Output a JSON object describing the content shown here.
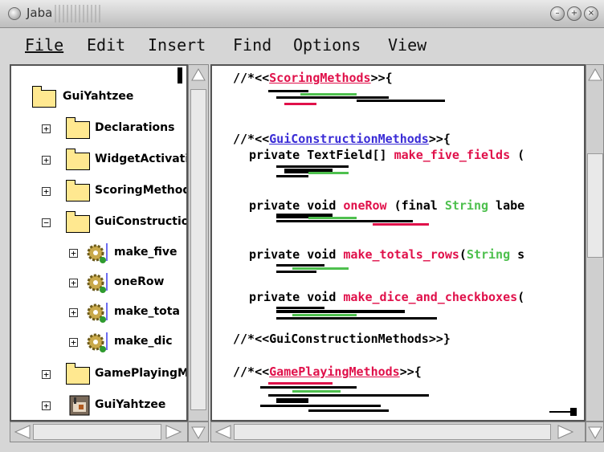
{
  "window": {
    "title": "Jaba"
  },
  "menu": [
    "File",
    "Edit",
    "Insert",
    "Find",
    "Options",
    "View"
  ],
  "tree": {
    "root": "GuiYahtzee",
    "nodes": [
      {
        "label": "Declarations",
        "expander": "+"
      },
      {
        "label": "WidgetActivatio",
        "expander": "+"
      },
      {
        "label": "ScoringMethod",
        "expander": "+"
      },
      {
        "label": "GuiConstructio",
        "expander": "−"
      },
      {
        "label": "make_five",
        "expander": "+"
      },
      {
        "label": "oneRow",
        "expander": "+"
      },
      {
        "label": "make_tota",
        "expander": "+"
      },
      {
        "label": "make_dic",
        "expander": "+"
      },
      {
        "label": "GamePlayingM",
        "expander": "+"
      },
      {
        "label": "GuiYahtzee",
        "expander": "+"
      }
    ]
  },
  "code": {
    "scoring_open": {
      "prefix": "//*<<",
      "name": "ScoringMethods",
      "suffix": ">>{"
    },
    "gui_open": {
      "prefix": "//*<<",
      "name": "GuiConstructionMethods",
      "suffix": ">>{"
    },
    "method1": {
      "pre": "private TextField[] ",
      "name": "make_five_fields",
      "post": " ("
    },
    "method2": {
      "pre": "private void ",
      "name": "oneRow",
      "post": " (final ",
      "type": "String",
      "rest": " labe"
    },
    "method3": {
      "pre": "private void ",
      "name": "make_totals_rows",
      "post": "(",
      "type": "String",
      "rest": " s"
    },
    "method4": {
      "pre": "private void ",
      "name": "make_dice_and_checkboxes",
      "post": "("
    },
    "gui_close": "//*<<GuiConstructionMethods>>}",
    "game_open": {
      "prefix": "//*<<",
      "name": "GamePlayingMethods",
      "suffix": ">>{"
    }
  },
  "colors": {
    "keyword_red": "#e0104a",
    "section_blue": "#3a2cd6",
    "type_green": "#4ec04e",
    "folder_yellow": "#ffe890"
  },
  "icons": {
    "folder": "folder-icon",
    "method": "gear-icon",
    "class": "class-icon"
  }
}
